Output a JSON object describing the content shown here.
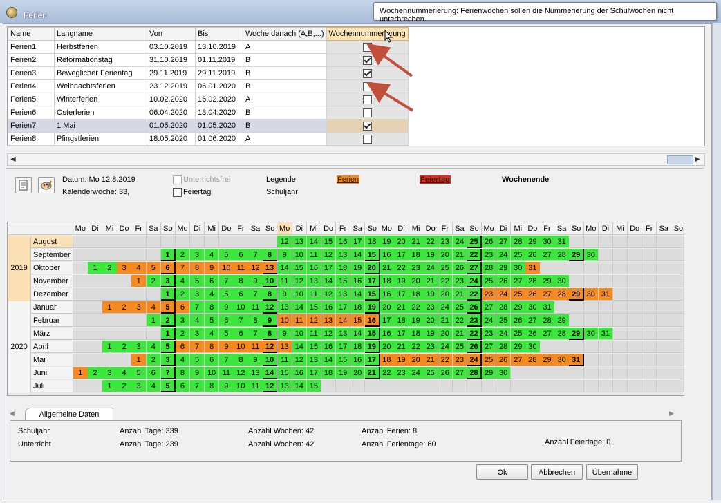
{
  "window": {
    "title": "Ferien"
  },
  "tooltip": "Wochennummerierung: Ferienwochen sollen die Nummerierung der Schulwochen nicht unterbrechen.",
  "grid": {
    "columns": [
      "Name",
      "Langname",
      "Von",
      "Bis",
      "Woche danach (A,B,...)",
      "Wochennummerierung"
    ],
    "rows": [
      {
        "name": "Ferien1",
        "langname": "Herbstferien",
        "von": "03.10.2019",
        "bis": "13.10.2019",
        "woche": "A",
        "checked": false
      },
      {
        "name": "Ferien2",
        "langname": "Reformationstag",
        "von": "31.10.2019",
        "bis": "01.11.2019",
        "woche": "B",
        "checked": true
      },
      {
        "name": "Ferien3",
        "langname": "Beweglicher Ferientag",
        "von": "29.11.2019",
        "bis": "29.11.2019",
        "woche": "B",
        "checked": true
      },
      {
        "name": "Ferien4",
        "langname": "Weihnachtsferien",
        "von": "23.12.2019",
        "bis": "06.01.2020",
        "woche": "B",
        "checked": false
      },
      {
        "name": "Ferien5",
        "langname": "Winterferien",
        "von": "10.02.2020",
        "bis": "16.02.2020",
        "woche": "A",
        "checked": false
      },
      {
        "name": "Ferien6",
        "langname": "Osterferien",
        "von": "06.04.2020",
        "bis": "13.04.2020",
        "woche": "B",
        "checked": false
      },
      {
        "name": "Ferien7",
        "langname": "1.Mai",
        "von": "01.05.2020",
        "bis": "01.05.2020",
        "woche": "B",
        "checked": true
      },
      {
        "name": "Ferien8",
        "langname": "Pfingstferien",
        "von": "18.05.2020",
        "bis": "01.06.2020",
        "woche": "A",
        "checked": false
      }
    ]
  },
  "info": {
    "datum": "Datum: Mo 12.8.2019",
    "kalenderwoche": "Kalenderwoche: 33,",
    "unterrichtsfrei": "Unterrichtsfrei",
    "feiertag": "Feiertag",
    "legende": "Legende",
    "schuljahr": "Schuljahr",
    "leg_ferien": "Ferien",
    "leg_feiertag": "Feiertag",
    "leg_wochenende": "Wochenende"
  },
  "calendar": {
    "day_headers": [
      "Mo",
      "Di",
      "Mi",
      "Do",
      "Fr",
      "Sa",
      "So"
    ],
    "year_2019": "2019",
    "year_2020": "2020",
    "months": [
      {
        "name": "August",
        "offset": 3,
        "days": 31
      },
      {
        "name": "September",
        "offset": 6,
        "days": 30
      },
      {
        "name": "Oktober",
        "offset": 1,
        "days": 31
      },
      {
        "name": "November",
        "offset": 4,
        "days": 30
      },
      {
        "name": "Dezember",
        "offset": 6,
        "days": 31
      },
      {
        "name": "Januar",
        "offset": 2,
        "days": 31
      },
      {
        "name": "Februar",
        "offset": 5,
        "days": 29
      },
      {
        "name": "März",
        "offset": 6,
        "days": 31
      },
      {
        "name": "April",
        "offset": 2,
        "days": 30
      },
      {
        "name": "Mai",
        "offset": 4,
        "days": 31
      },
      {
        "name": "Juni",
        "offset": 0,
        "days": 30
      },
      {
        "name": "Juli",
        "offset": 2,
        "days": 15
      }
    ],
    "holidays": {
      "2": [
        3,
        4,
        5,
        6,
        7,
        8,
        9,
        10,
        11,
        12,
        13,
        31
      ],
      "3": [
        1
      ],
      "4": [
        23,
        24,
        25,
        26,
        27,
        28,
        29,
        30,
        31
      ],
      "5": [
        1,
        2,
        3,
        4,
        5,
        6
      ],
      "6": [
        10,
        11,
        12,
        13,
        14,
        15,
        16
      ],
      "8": [
        6,
        7,
        8,
        9,
        10,
        11,
        12,
        13
      ],
      "9": [
        1,
        18,
        19,
        20,
        21,
        22,
        23,
        24,
        25,
        26,
        27,
        28,
        29,
        30,
        31
      ],
      "10": [
        1
      ]
    },
    "weekday_only": {
      "0": [
        12,
        13,
        14,
        15,
        16,
        17,
        18
      ],
      "1": []
    }
  },
  "bottom": {
    "tab": "Allgemeine Daten",
    "schuljahr": "Schuljahr",
    "unterricht": "Unterricht",
    "tage_s": "Anzahl Tage: 339",
    "tage_u": "Anzahl Tage: 239",
    "wochen_s": "Anzahl Wochen: 42",
    "wochen_u": "Anzahl Wochen: 42",
    "ferien": "Anzahl Ferien: 8",
    "ferientage": "Anzahl Ferientage: 60",
    "feiertage": "Anzahl Feiertage: 0"
  },
  "buttons": {
    "ok": "Ok",
    "cancel": "Abbrechen",
    "apply": "Übernahme"
  }
}
